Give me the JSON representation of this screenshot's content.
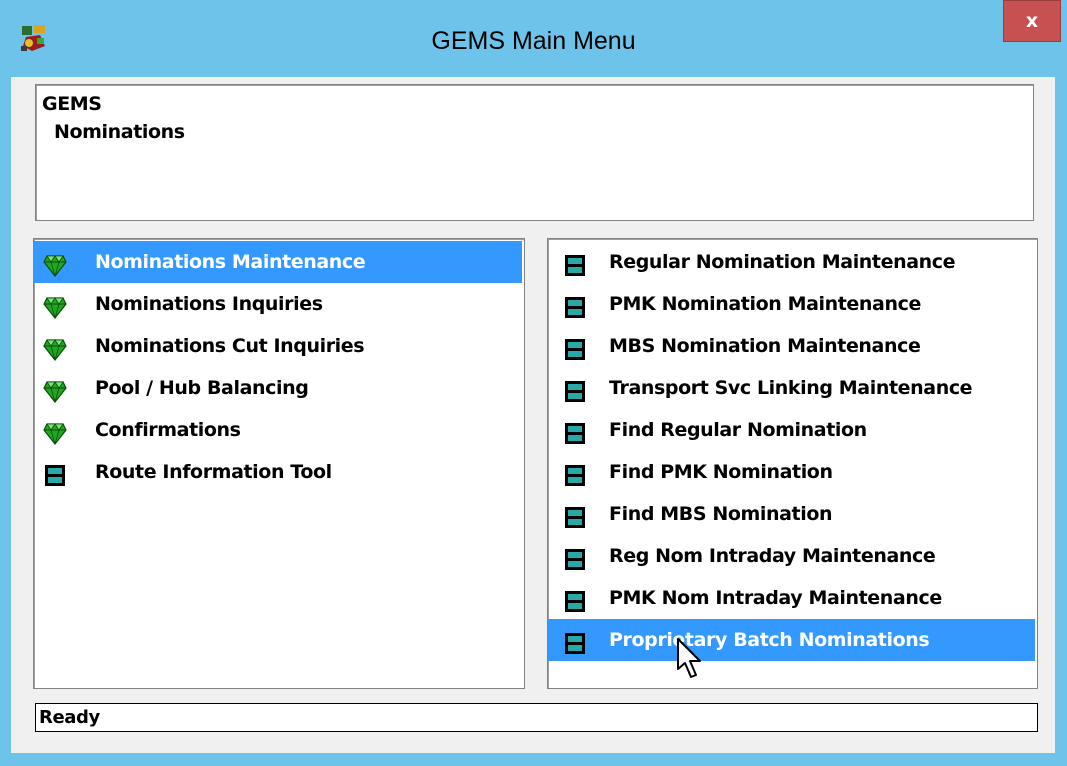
{
  "window": {
    "title": "GEMS Main Menu",
    "close_label": "x",
    "icon": "gems-app-icon"
  },
  "header": {
    "lines": [
      "GEMS",
      "Nominations"
    ]
  },
  "left_menu": {
    "items": [
      {
        "label": "Nominations Maintenance",
        "icon": "gem-icon",
        "selected": true
      },
      {
        "label": "Nominations Inquiries",
        "icon": "gem-icon",
        "selected": false
      },
      {
        "label": "Nominations Cut Inquiries",
        "icon": "gem-icon",
        "selected": false
      },
      {
        "label": "Pool / Hub Balancing",
        "icon": "gem-icon",
        "selected": false
      },
      {
        "label": "Confirmations",
        "icon": "gem-icon",
        "selected": false
      },
      {
        "label": "Route Information Tool",
        "icon": "program-window-icon",
        "selected": false
      }
    ]
  },
  "right_menu": {
    "items": [
      {
        "label": "Regular Nomination Maintenance",
        "icon": "program-window-icon",
        "selected": false
      },
      {
        "label": "PMK Nomination Maintenance",
        "icon": "program-window-icon",
        "selected": false
      },
      {
        "label": "MBS Nomination Maintenance",
        "icon": "program-window-icon",
        "selected": false
      },
      {
        "label": "Transport Svc Linking Maintenance",
        "icon": "program-window-icon",
        "selected": false
      },
      {
        "label": "Find Regular Nomination",
        "icon": "program-window-icon",
        "selected": false
      },
      {
        "label": "Find PMK Nomination",
        "icon": "program-window-icon",
        "selected": false
      },
      {
        "label": "Find MBS Nomination",
        "icon": "program-window-icon",
        "selected": false
      },
      {
        "label": "Reg Nom Intraday Maintenance",
        "icon": "program-window-icon",
        "selected": false
      },
      {
        "label": "PMK Nom Intraday Maintenance",
        "icon": "program-window-icon",
        "selected": false
      },
      {
        "label": "Proprietary Batch Nominations",
        "icon": "program-window-icon",
        "selected": true
      }
    ]
  },
  "status": {
    "text": "Ready"
  },
  "colors": {
    "title_bar": "#6dc3ea",
    "selection": "#3399ff",
    "close_button": "#c75050",
    "gem_green": "#1fa81f",
    "program_icon_teal": "#2aa7a7"
  }
}
